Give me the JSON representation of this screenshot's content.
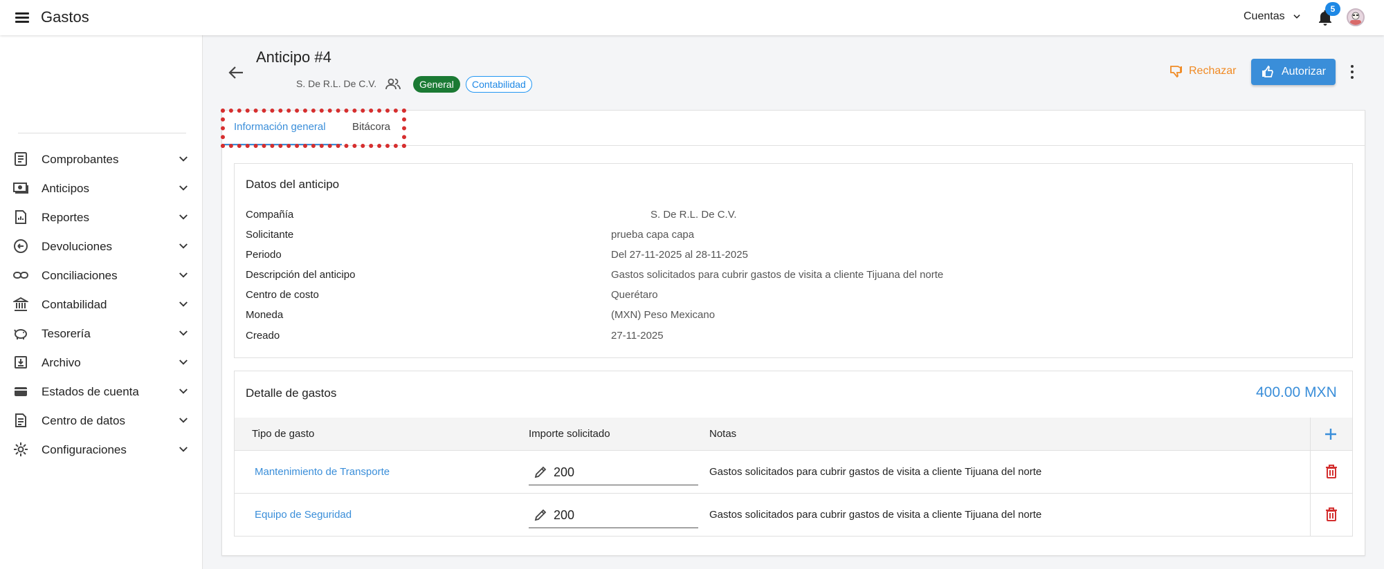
{
  "app": {
    "title": "Gastos",
    "accounts_label": "Cuentas",
    "notifications_count": "5"
  },
  "sidebar": {
    "items": [
      {
        "label": "Comprobantes",
        "icon": "document-icon"
      },
      {
        "label": "Anticipos",
        "icon": "cash-icon"
      },
      {
        "label": "Reportes",
        "icon": "report-icon"
      },
      {
        "label": "Devoluciones",
        "icon": "refund-icon"
      },
      {
        "label": "Conciliaciones",
        "icon": "link-icon"
      },
      {
        "label": "Contabilidad",
        "icon": "bank-icon"
      },
      {
        "label": "Tesorería",
        "icon": "piggy-bank-icon"
      },
      {
        "label": "Archivo",
        "icon": "archive-icon"
      },
      {
        "label": "Estados de cuenta",
        "icon": "card-icon"
      },
      {
        "label": "Centro de datos",
        "icon": "data-icon"
      },
      {
        "label": "Configuraciones",
        "icon": "gear-icon"
      }
    ]
  },
  "header": {
    "title": "Anticipo #4",
    "company": "S. De R.L. De C.V.",
    "badge_general": "General",
    "badge_contabilidad": "Contabilidad",
    "reject_label": "Rechazar",
    "authorize_label": "Autorizar"
  },
  "tabs": [
    {
      "label": "Información general"
    },
    {
      "label": "Bitácora"
    }
  ],
  "datos": {
    "title": "Datos del anticipo",
    "rows": [
      {
        "label": "Compañía",
        "value": "S. De R.L. De C.V."
      },
      {
        "label": "Solicitante",
        "value": "prueba capa capa"
      },
      {
        "label": "Periodo",
        "value": "Del 27-11-2025 al 28-11-2025"
      },
      {
        "label": "Descripción del anticipo",
        "value": "Gastos solicitados para cubrir gastos de visita a cliente Tijuana del norte"
      },
      {
        "label": "Centro de costo",
        "value": "Querétaro"
      },
      {
        "label": "Moneda",
        "value": "(MXN) Peso Mexicano"
      },
      {
        "label": "Creado",
        "value": "27-11-2025"
      }
    ]
  },
  "detalle": {
    "title": "Detalle de gastos",
    "total": "400.00 MXN",
    "columns": [
      "Tipo de gasto",
      "Importe solicitado",
      "Notas"
    ],
    "rows": [
      {
        "tipo": "Mantenimiento de Transporte",
        "importe": "200",
        "notas": "Gastos solicitados para cubrir gastos de visita a cliente Tijuana del norte"
      },
      {
        "tipo": "Equipo de Seguridad",
        "importe": "200",
        "notas": "Gastos solicitados para cubrir gastos de visita a cliente Tijuana del norte"
      }
    ]
  },
  "colors": {
    "accent": "#3a8ed9",
    "reject": "#f08a24",
    "general_badge": "#1b7a34",
    "delete": "#d32f2f"
  }
}
